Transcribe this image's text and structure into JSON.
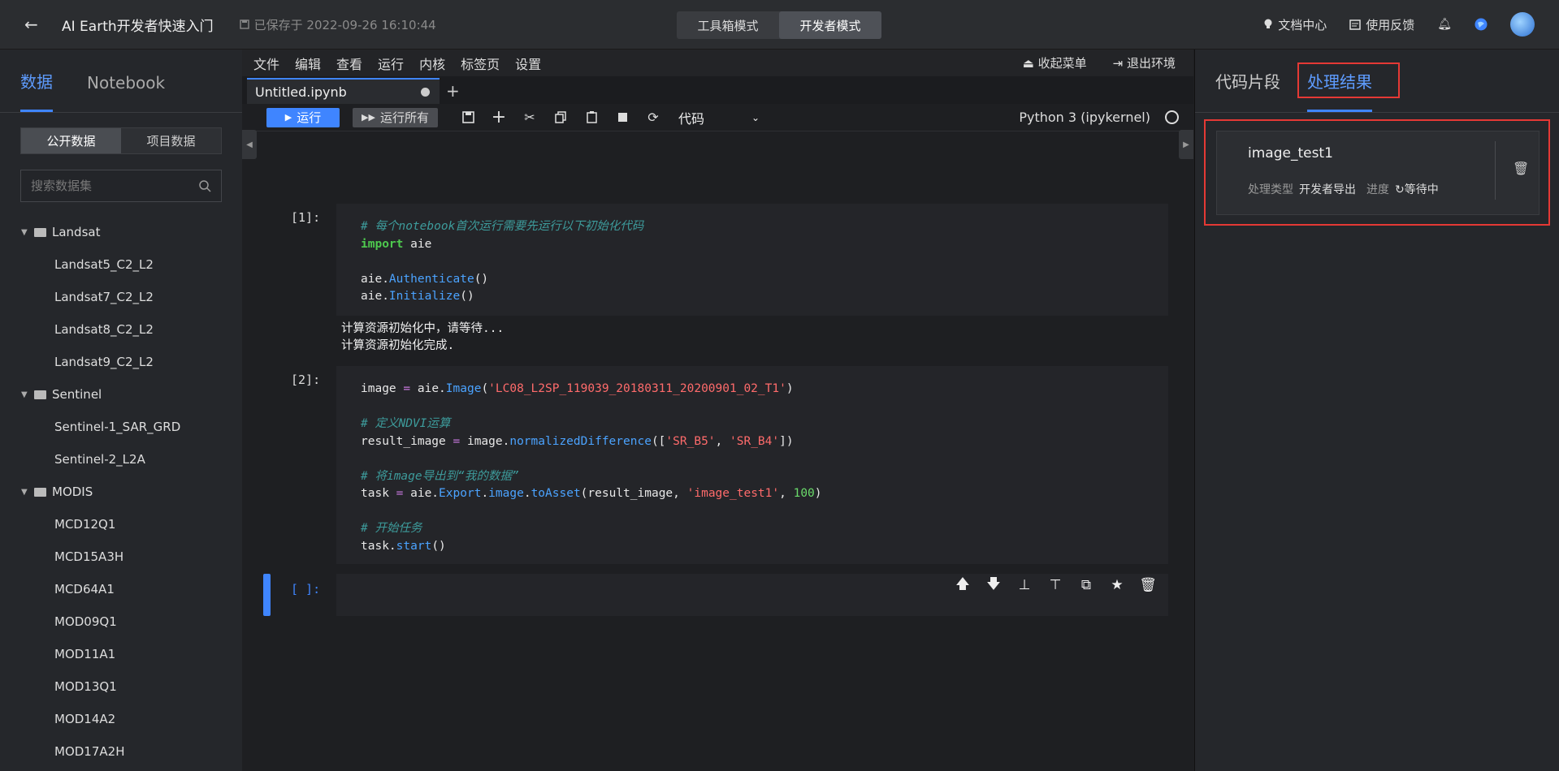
{
  "header": {
    "title": "AI Earth开发者快速入门",
    "saved": "已保存于 2022-09-26 16:10:44",
    "modes": [
      "工具箱模式",
      "开发者模式"
    ],
    "docs": "文档中心",
    "feedback": "使用反馈"
  },
  "left": {
    "tabs": [
      "数据",
      "Notebook"
    ],
    "segments": [
      "公开数据",
      "项目数据"
    ],
    "search_placeholder": "搜索数据集",
    "groups": [
      {
        "name": "Landsat",
        "items": [
          "Landsat5_C2_L2",
          "Landsat7_C2_L2",
          "Landsat8_C2_L2",
          "Landsat9_C2_L2"
        ]
      },
      {
        "name": "Sentinel",
        "items": [
          "Sentinel-1_SAR_GRD",
          "Sentinel-2_L2A"
        ]
      },
      {
        "name": "MODIS",
        "items": [
          "MCD12Q1",
          "MCD15A3H",
          "MCD64A1",
          "MOD09Q1",
          "MOD11A1",
          "MOD13Q1",
          "MOD14A2",
          "MOD17A2H"
        ]
      }
    ]
  },
  "notebook": {
    "menu": [
      "文件",
      "编辑",
      "查看",
      "运行",
      "内核",
      "标签页",
      "设置"
    ],
    "collapse_menu": "收起菜单",
    "exit_env": "退出环境",
    "file_tab": "Untitled.ipynb",
    "run": "运行",
    "run_all": "运行所有",
    "cell_type": "代码",
    "kernel": "Python 3 (ipykernel)",
    "cell1_prompt": "[1]:",
    "cell1_code": {
      "comment": "# 每个notebook首次运行需要先运行以下初始化代码",
      "import_kw": "import",
      "import_mod": " aie",
      "auth_obj": "aie.",
      "auth_fn": "Authenticate",
      "init_obj": "aie.",
      "init_fn": "Initialize",
      "parens": "()"
    },
    "cell1_output": [
      "计算资源初始化中，请等待...",
      "计算资源初始化完成."
    ],
    "cell2_prompt": "[2]:",
    "cell2_code": {
      "image_var": "image",
      "image_fn": "Image",
      "image_arg": "'LC08_L2SP_119039_20180311_20200901_02_T1'",
      "comment_ndvi": "# 定义NDVI运算",
      "result_var": "result_image",
      "nd_fn": "normalizedDifference",
      "band1": "'SR_B5'",
      "band2": "'SR_B4'",
      "comment_export": "# 将image导出到“我的数据”",
      "task_var": "task",
      "export_fn": "Export",
      "image_attr": "image",
      "to_asset_fn": "toAsset",
      "asset_name": "'image_test1'",
      "asset_num": "100",
      "comment_start": "# 开始任务",
      "start_fn": "start"
    },
    "cell3_prompt": "[ ]:"
  },
  "right": {
    "tabs": [
      "代码片段",
      "处理结果"
    ],
    "task_name": "image_test1",
    "type_label": "处理类型",
    "type_value": "开发者导出",
    "progress_label": "进度",
    "progress_value": "等待中"
  },
  "colors": {
    "accent": "#3f85ff",
    "highlight_box": "#e53935"
  }
}
